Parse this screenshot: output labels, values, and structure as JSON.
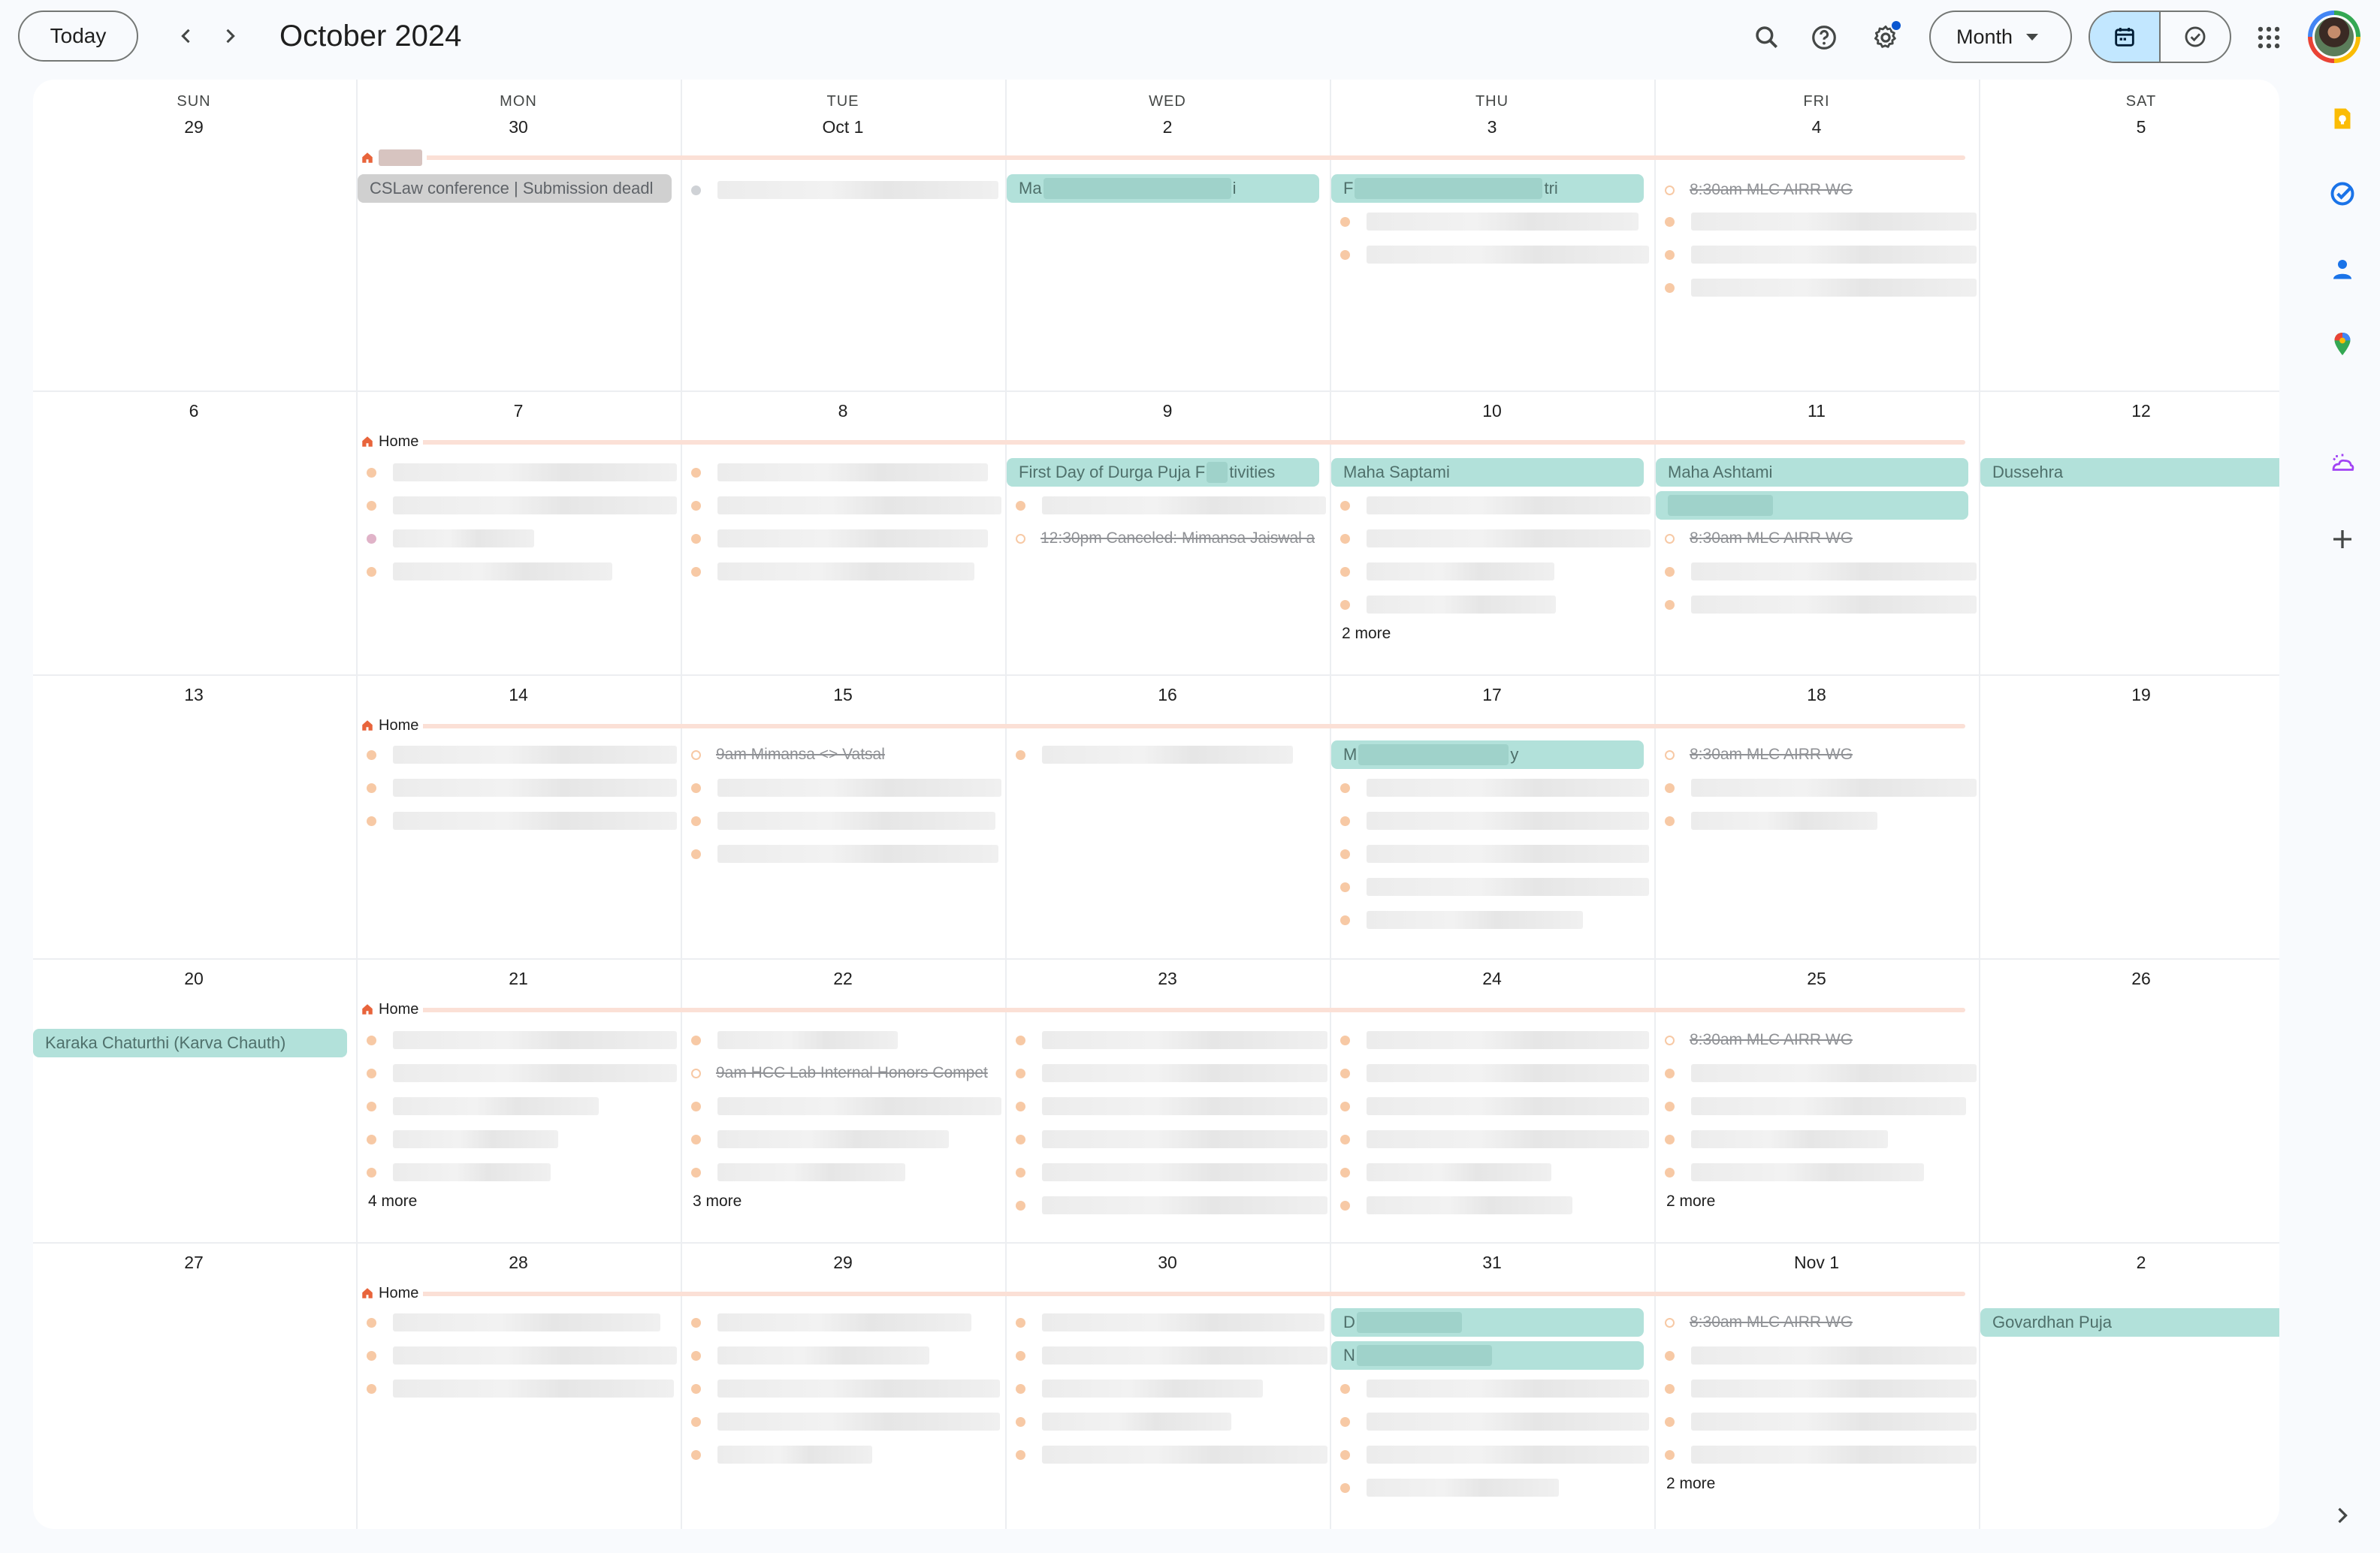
{
  "header": {
    "today_label": "Today",
    "month_title": "October 2024",
    "view_label": "Month"
  },
  "weekdays": [
    "SUN",
    "MON",
    "TUE",
    "WED",
    "THU",
    "FRI",
    "SAT"
  ],
  "weeks": [
    [
      "29",
      "30",
      "Oct 1",
      "2",
      "3",
      "4",
      "5"
    ],
    [
      "6",
      "7",
      "8",
      "9",
      "10",
      "11",
      "12"
    ],
    [
      "13",
      "14",
      "15",
      "16",
      "17",
      "18",
      "19"
    ],
    [
      "20",
      "21",
      "22",
      "23",
      "24",
      "25",
      "26"
    ],
    [
      "27",
      "28",
      "29",
      "30",
      "31",
      "Nov 1",
      "2"
    ]
  ],
  "events": {
    "home": "Home",
    "cslaw": "CSLaw conference | Submission deadl",
    "wk1_wed_prefix": "Ma",
    "wk1_wed_suffix": "i",
    "wk1_thu_prefix": "F",
    "wk1_thu_suffix": "tri",
    "mlc": "8:30am MLC AIRR WG",
    "durga_a": "First Day of Durga Puja F",
    "durga_b": "tivities",
    "canceled": "12:30pm Canceled: Mimansa Jaiswal a",
    "maha_saptami": "Maha Saptami",
    "maha_ashtami": "Maha Ashtami",
    "dussehra": "Dussehra",
    "mimansa": "9am Mimansa <> Vatsal",
    "wk3_thu_prefix": "M",
    "wk3_thu_suffix": "y",
    "karva": "Karaka Chaturthi (Karva Chauth)",
    "hcc": "9am HCC Lab Internal Honors Compet",
    "wk5_thu_a": "D",
    "wk5_thu_b": "N",
    "govardhan": "Govardhan Puja"
  },
  "more_links": {
    "wk2_thu": "2 more",
    "wk4_mon": "4 more",
    "wk4_tue": "3 more",
    "wk4_fri": "2 more",
    "wk5_fri": "2 more"
  },
  "icons": {
    "search": "search-icon",
    "help": "help-icon",
    "settings": "settings-icon",
    "calendar_view": "calendar-icon",
    "tasks_view": "check-circle-icon",
    "apps": "apps-grid-icon",
    "keep": "keep-icon",
    "tasks": "tasks-icon",
    "contacts": "contacts-icon",
    "maps": "maps-icon",
    "weather": "weather-icon",
    "add": "plus-icon",
    "expand": "chevron-right-icon"
  },
  "colors": {
    "accent": "#c2e7ff",
    "holiday_chip": "#b2e1da",
    "event_dot": "#f7c9a5",
    "home_bar": "#fbe0d6",
    "home_icon": "#e8643b"
  }
}
